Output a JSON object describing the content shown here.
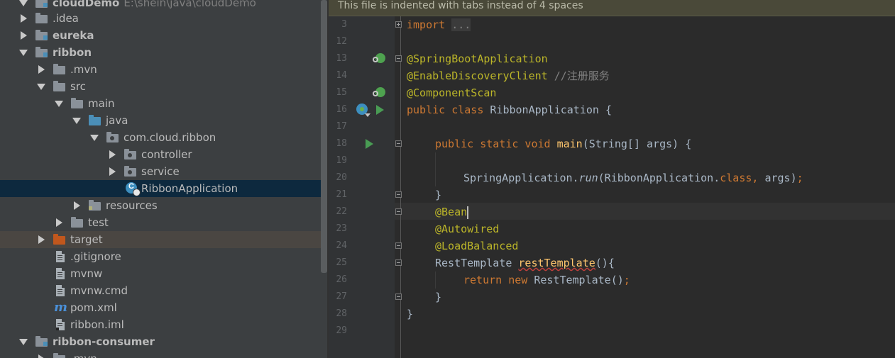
{
  "banner": {
    "text": "This file is indented with tabs instead of 4 spaces"
  },
  "project_tree": {
    "root": {
      "label": "cloudDemo",
      "path": "E:\\shein\\java\\cloudDemo"
    },
    "items": [
      {
        "label": "idea",
        "display": ".idea"
      },
      {
        "label": "eureka"
      },
      {
        "label": "ribbon"
      },
      {
        "label": ".mvn"
      },
      {
        "label": "src"
      },
      {
        "label": "main"
      },
      {
        "label": "java"
      },
      {
        "label": "com.cloud.ribbon"
      },
      {
        "label": "controller"
      },
      {
        "label": "service"
      },
      {
        "label": "RibbonApplication"
      },
      {
        "label": "resources"
      },
      {
        "label": "test"
      },
      {
        "label": "target"
      },
      {
        "label": ".gitignore"
      },
      {
        "label": "mvnw"
      },
      {
        "label": "mvnw.cmd"
      },
      {
        "label": "pom.xml"
      },
      {
        "label": "ribbon.iml"
      },
      {
        "label": "ribbon-consumer"
      },
      {
        "label": ".mvn"
      }
    ]
  },
  "editor": {
    "line_numbers": [
      "3",
      "12",
      "13",
      "14",
      "15",
      "16",
      "17",
      "18",
      "19",
      "20",
      "21",
      "22",
      "23",
      "24",
      "25",
      "26",
      "27",
      "28",
      "29"
    ],
    "lines": {
      "l3_kw": "import",
      "l3_fold": "...",
      "l13_ann": "@SpringBootApplication",
      "l14_ann": "@EnableDiscoveryClient",
      "l14_comment": "//注册服务",
      "l15_ann": "@ComponentScan",
      "l16_kw": "public class",
      "l16_rest": " RibbonApplication {",
      "l18_kw": "public static void",
      "l18_name": "main",
      "l18_rest": "(String[] args) {",
      "l20_a": "SpringApplication.",
      "l20_b": "run",
      "l20_c": "(RibbonApplication.",
      "l20_d": "class,",
      "l20_e": " args)",
      "l20_f": ";",
      "l21": "}",
      "l22_ann": "@Bean",
      "l23_ann": "@Autowired",
      "l24_ann": "@LoadBalanced",
      "l25_type": "RestTemplate ",
      "l25_name": "restTemplate",
      "l25_rest": "(){",
      "l26_kw1": "return",
      "l26_kw2": "new",
      "l26_rest": " RestTemplate()",
      "l26_semi": ";",
      "l27": "}",
      "l28": "}"
    }
  },
  "colors": {
    "keyword": "#cc7832",
    "annotation": "#bbb529",
    "comment": "#808080",
    "method": "#ffc66d",
    "text": "#a9b7c6",
    "selection": "#0d293e"
  }
}
